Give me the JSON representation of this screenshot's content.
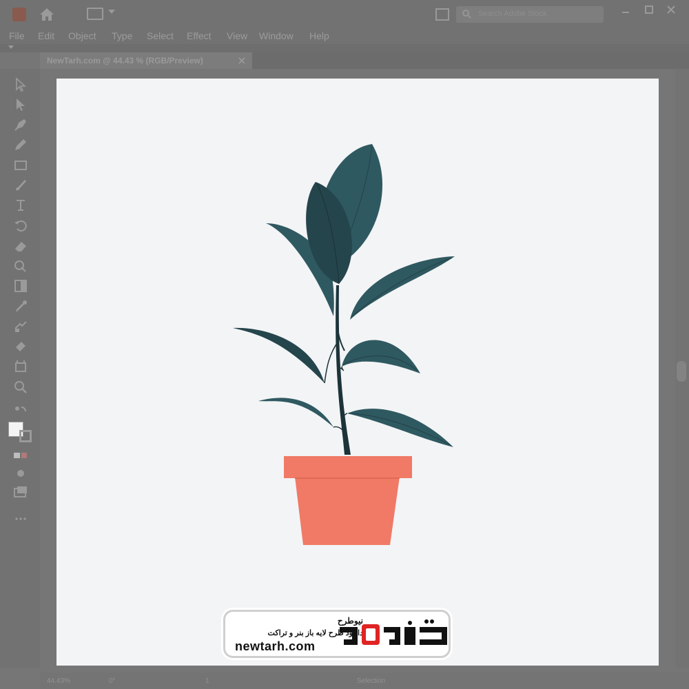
{
  "app": {
    "search_placeholder": "Search Adobe Stock"
  },
  "menu": [
    "File",
    "Edit",
    "Object",
    "Type",
    "Select",
    "Effect",
    "View",
    "Window",
    "Help"
  ],
  "document": {
    "tab_label": "NewTarh.com @ 44.43 % (RGB/Preview)"
  },
  "toolbar": {
    "tools": [
      "selection-tool",
      "direct-selection-tool",
      "pen-tool",
      "pencil-tool",
      "rectangle-tool",
      "paintbrush-tool",
      "type-tool",
      "rotate-tool",
      "eraser-tool",
      "shape-builder-tool",
      "gradient-tool",
      "eyedropper-tool",
      "blend-tool",
      "symbol-sprayer-tool",
      "artboard-tool",
      "hand-tool",
      "zoom-tool"
    ]
  },
  "status": {
    "zoom": "44.43%",
    "rotation": "0°",
    "artboard": "1",
    "tool": "Selection"
  },
  "artwork": {
    "colors": {
      "artboard": "#f3f4f6",
      "leaf": "#2f5961",
      "leaf_dark": "#25454c",
      "stem": "#1c3439",
      "pot": "#f07a66",
      "pot_rim": "#f07a66"
    }
  },
  "watermark": {
    "title_fa": "نیوطرح",
    "subtitle_fa": "دانلود طرح لایه باز بنر و تراکت",
    "domain": "newtarh.com",
    "brand_mark": "نیوطرح",
    "colors": {
      "accent": "#e02424",
      "text": "#111111"
    }
  }
}
